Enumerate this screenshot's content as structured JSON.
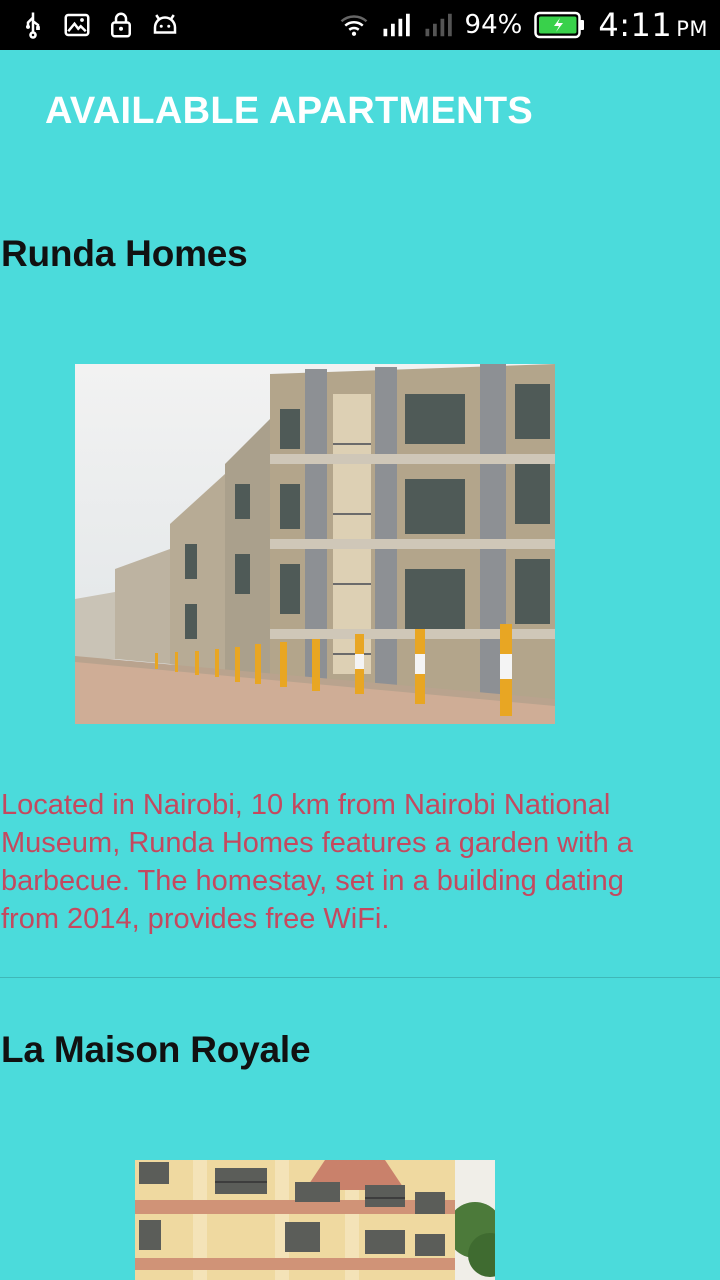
{
  "status_bar": {
    "icons_left": [
      "usb-icon",
      "image-icon",
      "lock-icon",
      "android-icon"
    ],
    "icons_right": [
      "wifi-icon",
      "signal-icon",
      "signal-weak-icon"
    ],
    "battery_percent": "94%",
    "time": "4:11",
    "ampm": "PM",
    "battery_color": "#39d14b"
  },
  "header": {
    "title": "AVAILABLE APARTMENTS"
  },
  "listings": [
    {
      "name": "Runda Homes",
      "description": "Located in Nairobi, 10 km from Nairobi National Museum, Runda Homes features a garden with a barbecue. The homestay, set in a building dating from 2014, provides free WiFi."
    },
    {
      "name": "La Maison Royale"
    }
  ],
  "colors": {
    "background": "#4bdbdb",
    "title": "#ffffff",
    "description": "#c4495f"
  }
}
